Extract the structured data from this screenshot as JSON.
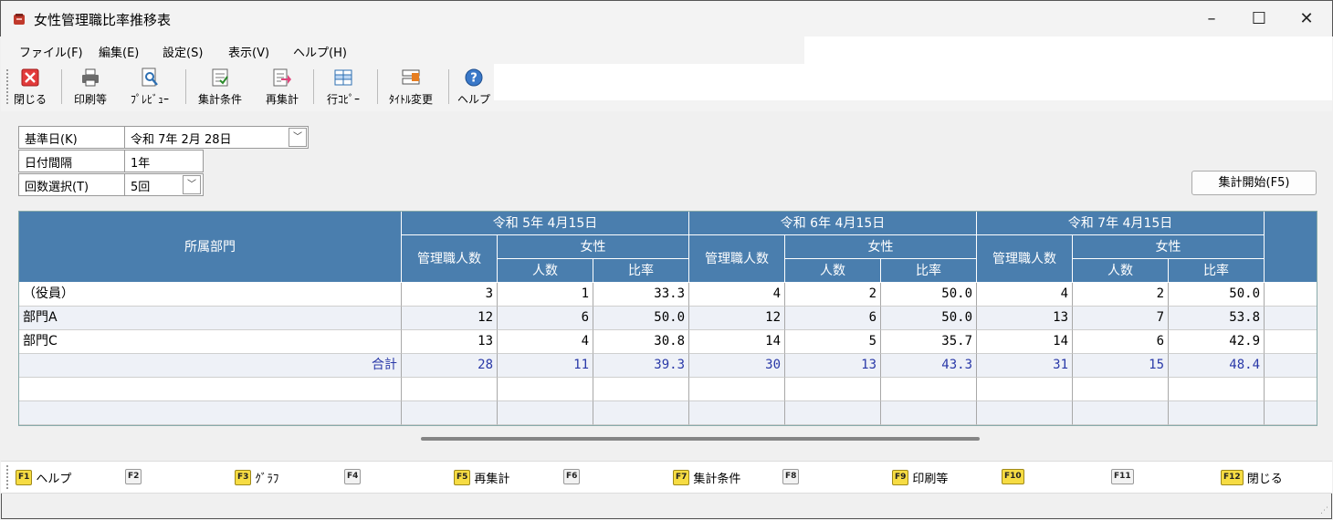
{
  "window": {
    "title": "女性管理職比率推移表",
    "minimize": "–",
    "maximize": "☐",
    "close": "✕"
  },
  "menu": [
    "ファイル(F)",
    "編集(E)",
    "設定(S)",
    "表示(V)",
    "ヘルプ(H)"
  ],
  "toolbar": [
    {
      "label": "閉じる",
      "icon": "close-icon"
    },
    {
      "label": "印刷等",
      "icon": "printer-icon"
    },
    {
      "label": "ﾌﾟﾚﾋﾞｭｰ",
      "icon": "preview-icon"
    },
    {
      "label": "集計条件",
      "icon": "conditions-icon"
    },
    {
      "label": "再集計",
      "icon": "recalc-icon"
    },
    {
      "label": "行ｺﾋﾟｰ",
      "icon": "row-copy-icon"
    },
    {
      "label": "ﾀｲﾄﾙ変更",
      "icon": "title-change-icon"
    },
    {
      "label": "ヘルプ",
      "icon": "help-icon"
    }
  ],
  "params": {
    "base_date": {
      "label": "基準日(K)",
      "value": "令和  7年  2月 28日"
    },
    "interval": {
      "label": "日付間隔",
      "value": "1年"
    },
    "count": {
      "label": "回数選択(T)",
      "value": "5回"
    }
  },
  "start_button": "集計開始(F5)",
  "table": {
    "dept_header": "所属部門",
    "periods": [
      "令和 5年 4月15日",
      "令和 6年 4月15日",
      "令和 7年 4月15日"
    ],
    "sub_headers": {
      "managers": "管理職人数",
      "female": "女性",
      "count": "人数",
      "ratio": "比率"
    },
    "rows": [
      {
        "dept": "（役員）",
        "values": [
          "3",
          "1",
          "33.3",
          "4",
          "2",
          "50.0",
          "4",
          "2",
          "50.0"
        ]
      },
      {
        "dept": "部門A",
        "values": [
          "12",
          "6",
          "50.0",
          "12",
          "6",
          "50.0",
          "13",
          "7",
          "53.8"
        ]
      },
      {
        "dept": "部門C",
        "values": [
          "13",
          "4",
          "30.8",
          "14",
          "5",
          "35.7",
          "14",
          "6",
          "42.9"
        ]
      }
    ],
    "total": {
      "label": "合計",
      "values": [
        "28",
        "11",
        "39.3",
        "30",
        "13",
        "43.3",
        "31",
        "15",
        "48.4"
      ]
    }
  },
  "fkeys": [
    {
      "key": "F1",
      "label": "ヘルプ",
      "active": true
    },
    {
      "key": "F2",
      "label": "",
      "active": false
    },
    {
      "key": "F3",
      "label": "ｸﾞﾗﾌ",
      "active": true
    },
    {
      "key": "F4",
      "label": "",
      "active": false
    },
    {
      "key": "F5",
      "label": "再集計",
      "active": true
    },
    {
      "key": "F6",
      "label": "",
      "active": false
    },
    {
      "key": "F7",
      "label": "集計条件",
      "active": true
    },
    {
      "key": "F8",
      "label": "",
      "active": false
    },
    {
      "key": "F9",
      "label": "印刷等",
      "active": true
    },
    {
      "key": "F10",
      "label": "",
      "active": true
    },
    {
      "key": "F11",
      "label": "",
      "active": false
    },
    {
      "key": "F12",
      "label": "閉じる",
      "active": true
    }
  ],
  "colors": {
    "header_bg": "#4a7eae",
    "total_text": "#2a39a8",
    "fkey_active": "#f6dc43"
  }
}
